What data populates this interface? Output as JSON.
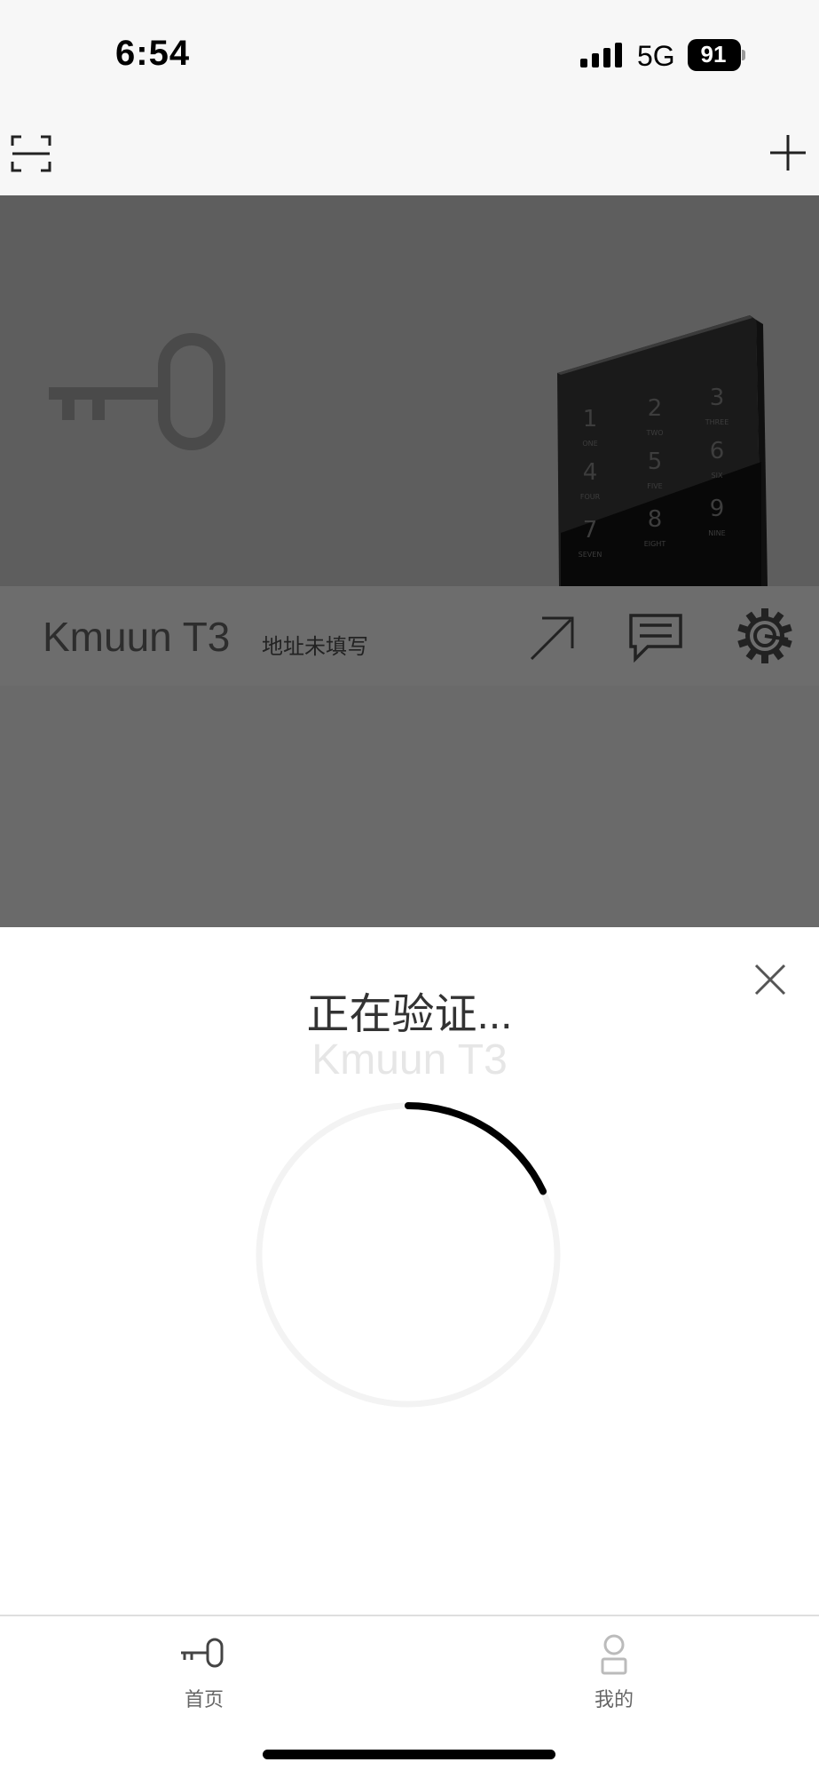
{
  "status_bar": {
    "time": "6:54",
    "network": "5G",
    "battery": "91"
  },
  "toolbar": {
    "scan_icon": "scan-icon",
    "add_icon": "plus-icon"
  },
  "device": {
    "name": "Kmuun T3",
    "address": "地址未填写"
  },
  "lock_keypad": {
    "digits": [
      "1",
      "2",
      "3",
      "4",
      "5",
      "6",
      "7",
      "8",
      "9"
    ],
    "words": [
      "ONE",
      "TWO",
      "THREE",
      "FOUR",
      "FIVE",
      "SIX",
      "SEVEN",
      "EIGHT",
      "NINE"
    ]
  },
  "verify": {
    "title": "正在验证...",
    "device_name": "Kmuun T3",
    "progress": 0.18
  },
  "tabs": [
    {
      "label": "首页",
      "icon": "key-icon",
      "active": true
    },
    {
      "label": "我的",
      "icon": "person-icon",
      "active": false
    }
  ],
  "colors": {
    "hero_bg": "#5e5e5e",
    "device_bar_bg": "#6d6d6d",
    "spinner_track": "#f3f3f3",
    "spinner_arc": "#000000"
  }
}
